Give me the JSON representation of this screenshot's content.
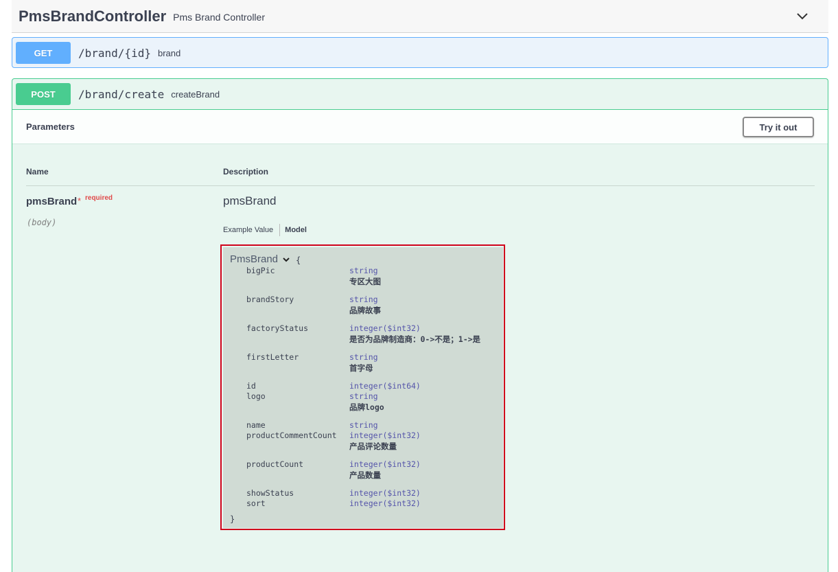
{
  "tag": {
    "name": "PmsBrandController",
    "description": "Pms Brand Controller"
  },
  "operations": [
    {
      "method": "GET",
      "path": "/brand/{id}",
      "summary": "brand"
    },
    {
      "method": "POST",
      "path": "/brand/create",
      "summary": "createBrand"
    }
  ],
  "params": {
    "title": "Parameters",
    "try_label": "Try it out",
    "col_name": "Name",
    "col_description": "Description",
    "param": {
      "name": "pmsBrand",
      "star": "*",
      "required": "required",
      "in": "(body)",
      "description": "pmsBrand"
    },
    "tabs": {
      "example": "Example Value",
      "model": "Model"
    }
  },
  "model": {
    "title": "PmsBrand",
    "open_brace": "{",
    "close_brace": "}",
    "properties": [
      {
        "name": "bigPic",
        "type": "string",
        "desc": "专区大图"
      },
      {
        "name": "brandStory",
        "type": "string",
        "desc": "品牌故事"
      },
      {
        "name": "factoryStatus",
        "type": "integer($int32)",
        "desc": "是否为品牌制造商：0->不是；1->是"
      },
      {
        "name": "firstLetter",
        "type": "string",
        "desc": "首字母"
      },
      {
        "name": "id",
        "type": "integer($int64)",
        "desc": ""
      },
      {
        "name": "logo",
        "type": "string",
        "desc": "品牌logo"
      },
      {
        "name": "name",
        "type": "string",
        "desc": ""
      },
      {
        "name": "productCommentCount",
        "type": "integer($int32)",
        "desc": "产品评论数量"
      },
      {
        "name": "productCount",
        "type": "integer($int32)",
        "desc": "产品数量"
      },
      {
        "name": "showStatus",
        "type": "integer($int32)",
        "desc": ""
      },
      {
        "name": "sort",
        "type": "integer($int32)",
        "desc": ""
      }
    ]
  },
  "colors": {
    "get": "#61affe",
    "post": "#49cc90",
    "highlight": "#d0021b"
  }
}
